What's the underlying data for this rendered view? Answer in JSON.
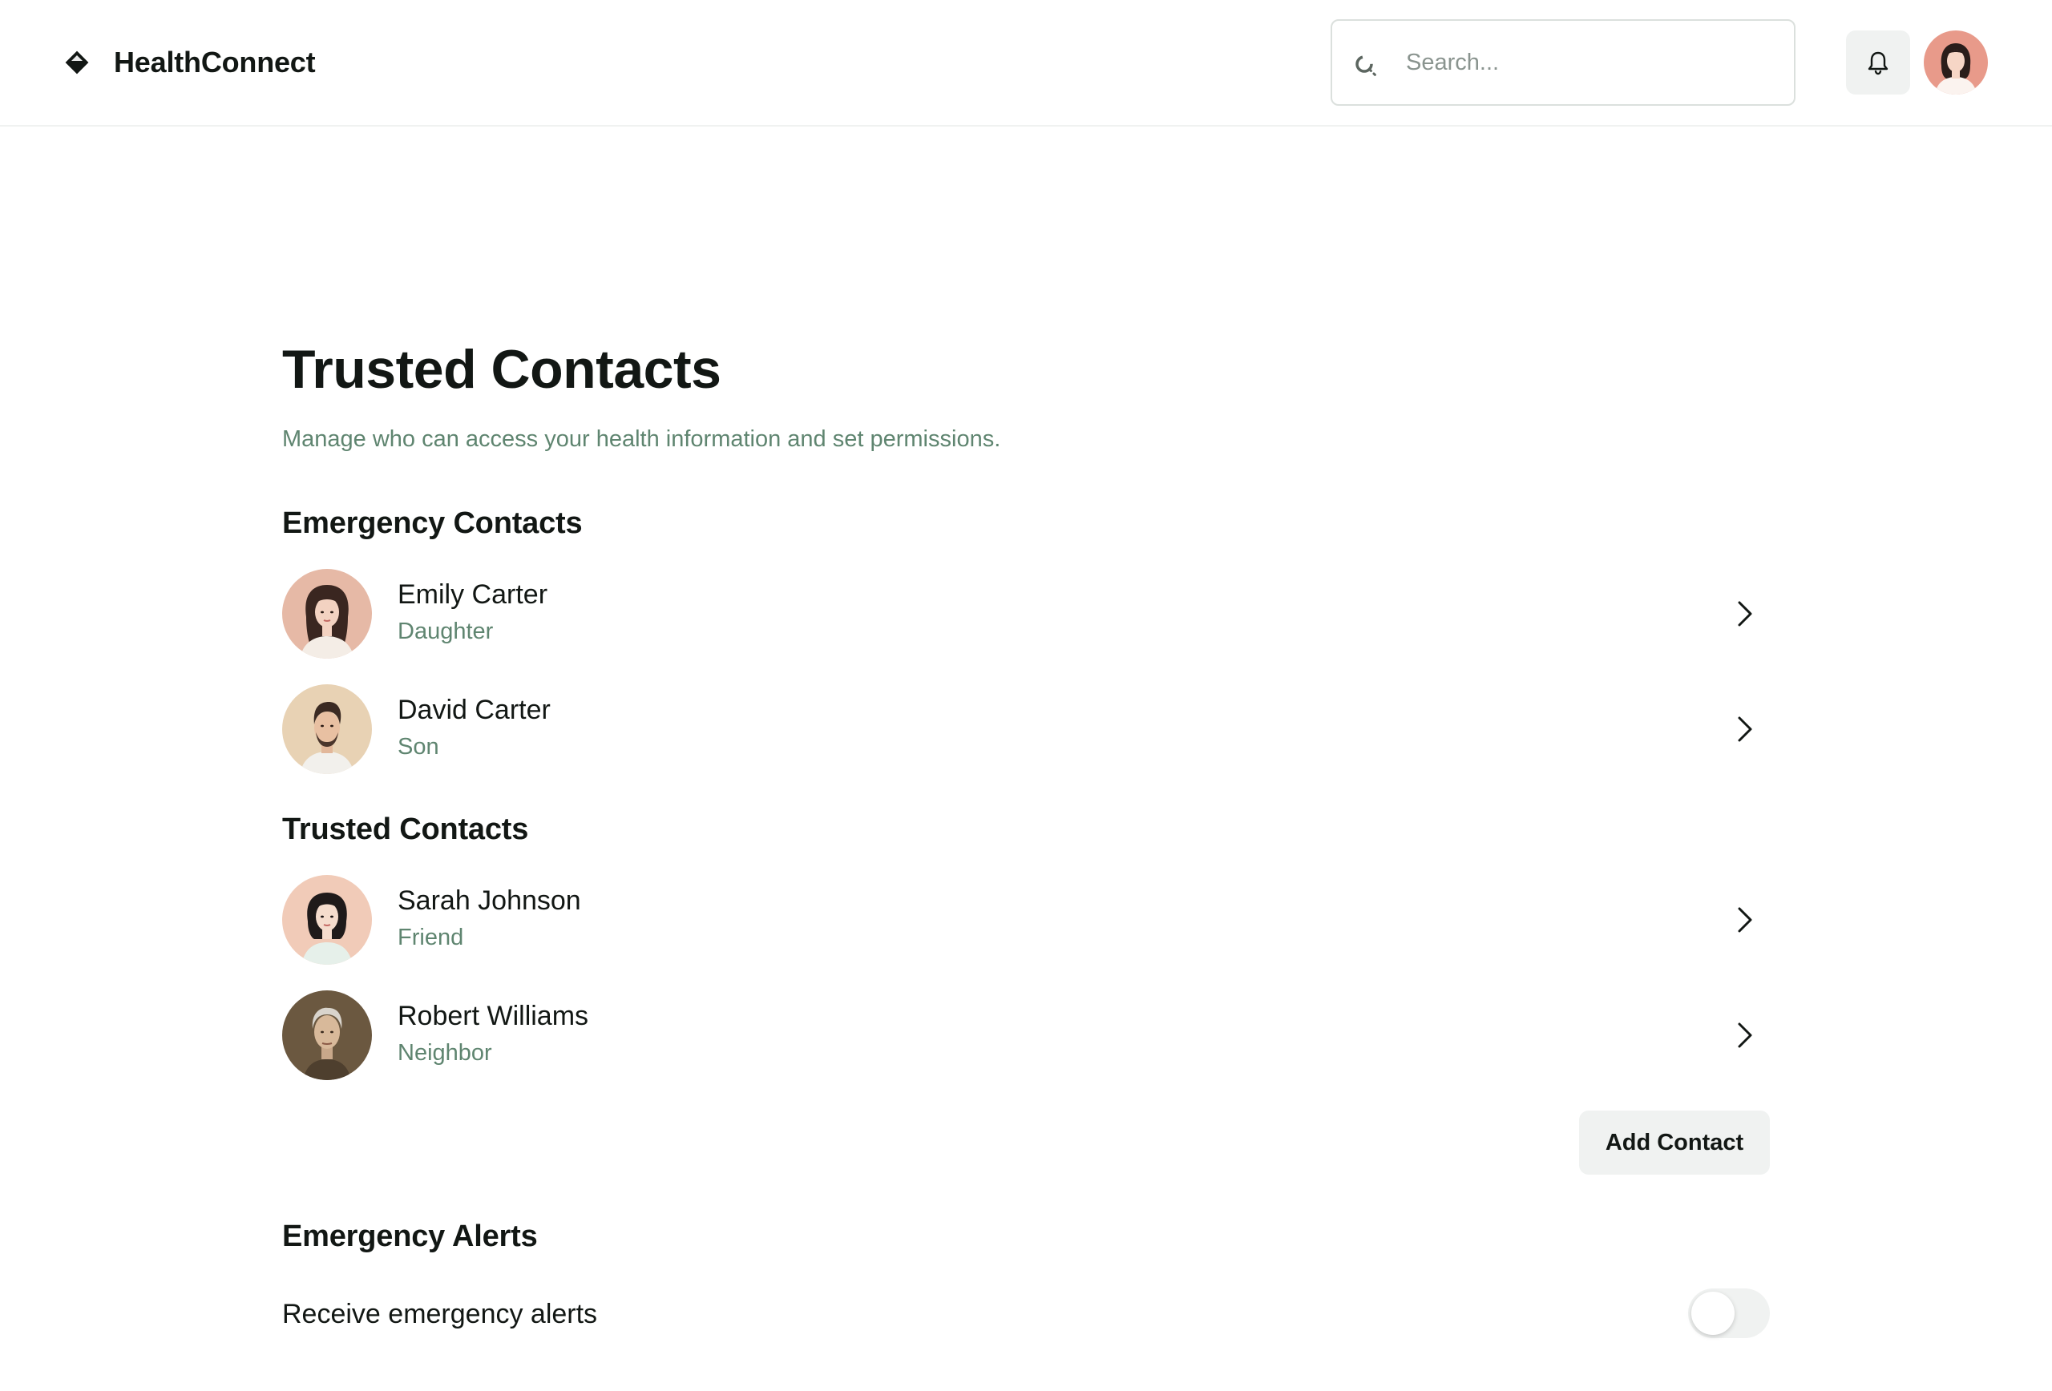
{
  "app": {
    "name": "HealthConnect"
  },
  "header": {
    "search_placeholder": "Search...",
    "notifications_icon": "bell-icon",
    "profile_avatar": "user-avatar"
  },
  "page": {
    "title": "Trusted Contacts",
    "subtitle": "Manage who can access your health information and set permissions."
  },
  "emergency_contacts": {
    "title": "Emergency Contacts",
    "items": [
      {
        "name": "Emily Carter",
        "relation": "Daughter"
      },
      {
        "name": "David Carter",
        "relation": "Son"
      }
    ]
  },
  "trusted_contacts": {
    "title": "Trusted Contacts",
    "items": [
      {
        "name": "Sarah Johnson",
        "relation": "Friend"
      },
      {
        "name": "Robert Williams",
        "relation": "Neighbor"
      }
    ]
  },
  "actions": {
    "add_contact_label": "Add Contact"
  },
  "emergency_alerts": {
    "title": "Emergency Alerts",
    "receive_label": "Receive emergency alerts",
    "enabled": false
  },
  "colors": {
    "accent_text": "#5f8570",
    "surface": "#f0f2f1",
    "text": "#121714"
  }
}
